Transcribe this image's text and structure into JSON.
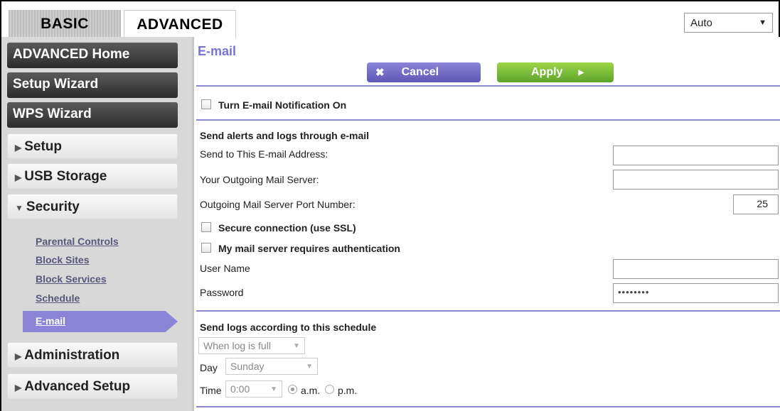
{
  "tabs": {
    "basic": "BASIC",
    "advanced": "ADVANCED"
  },
  "language": {
    "selected": "Auto"
  },
  "nav": {
    "advanced_home": "ADVANCED Home",
    "setup_wizard": "Setup Wizard",
    "wps_wizard": "WPS Wizard",
    "setup": "Setup",
    "usb_storage": "USB Storage",
    "security": "Security",
    "security_items": [
      "Parental Controls",
      "Block Sites",
      "Block Services",
      "Schedule",
      "E-mail"
    ],
    "administration": "Administration",
    "advanced_setup": "Advanced Setup"
  },
  "page": {
    "title": "E-mail",
    "cancel_label": "Cancel",
    "apply_label": "Apply",
    "notification_label": "Turn E-mail Notification On",
    "section_alerts": "Send alerts and logs through e-mail",
    "send_to_label": "Send to This E-mail Address:",
    "send_to_value": "",
    "outgoing_server_label": "Your Outgoing Mail Server:",
    "outgoing_server_value": "",
    "port_label": "Outgoing Mail Server Port Number:",
    "port_value": "25",
    "ssl_label": "Secure connection (use SSL)",
    "auth_label": "My mail server requires authentication",
    "username_label": "User Name",
    "username_value": "",
    "password_label": "Password",
    "password_value": "••••••••",
    "section_schedule": "Send logs according to this schedule",
    "schedule_select": "When log is full",
    "day_label": "Day",
    "day_select": "Sunday",
    "time_label": "Time",
    "time_select": "0:00",
    "am_label": "a.m.",
    "pm_label": "p.m."
  },
  "colors": {
    "accent": "#7a72d6",
    "apply": "#6cb33a",
    "cancel": "#6b65c2"
  }
}
